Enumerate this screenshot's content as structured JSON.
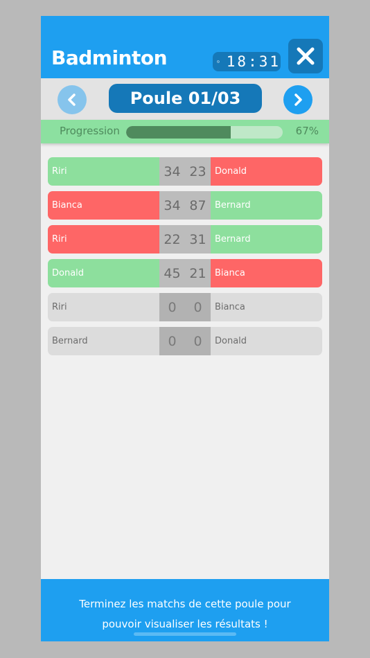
{
  "header": {
    "title": "Badminton",
    "timer": "18:31",
    "close_icon": "close-icon",
    "clock_icon": "clock-icon"
  },
  "nav": {
    "pool_label": "Poule 01/03",
    "prev_icon": "chevron-left-icon",
    "next_icon": "chevron-right-icon"
  },
  "progress": {
    "label": "Progression",
    "percent_text": "67%",
    "fraction": 0.67
  },
  "matches": [
    {
      "left": "Riri",
      "score_left": "34",
      "score_right": "23",
      "right": "Donald",
      "left_state": "win",
      "right_state": "lose"
    },
    {
      "left": "Bianca",
      "score_left": "34",
      "score_right": "87",
      "right": "Bernard",
      "left_state": "lose",
      "right_state": "win"
    },
    {
      "left": "Riri",
      "score_left": "22",
      "score_right": "31",
      "right": "Bernard",
      "left_state": "lose",
      "right_state": "win"
    },
    {
      "left": "Donald",
      "score_left": "45",
      "score_right": "21",
      "right": "Bianca",
      "left_state": "win",
      "right_state": "lose"
    },
    {
      "left": "Riri",
      "score_left": "0",
      "score_right": "0",
      "right": "Bianca",
      "left_state": "pending",
      "right_state": "pending"
    },
    {
      "left": "Bernard",
      "score_left": "0",
      "score_right": "0",
      "right": "Donald",
      "left_state": "pending",
      "right_state": "pending"
    }
  ],
  "footer": {
    "line1": "Terminez les matchs de cette poule pour",
    "line2": "pouvoir visualiser les résultats !"
  },
  "colors": {
    "primary": "#1e9ff0",
    "primary_dark": "#1578b8",
    "win": "#8ddf9d",
    "lose": "#fe6666",
    "pending": "#dcdcdc"
  }
}
